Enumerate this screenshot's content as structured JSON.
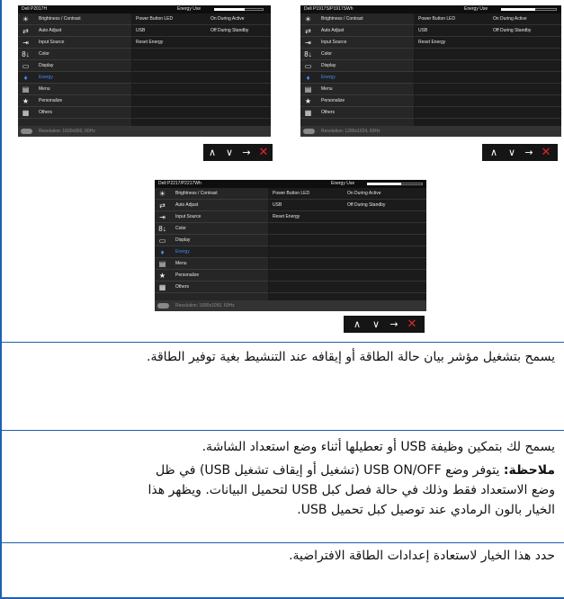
{
  "osd": {
    "menu": [
      {
        "icon": "☀",
        "icon_name": "brightness-icon",
        "label": "Brightness / Contrast"
      },
      {
        "icon": "⇄",
        "icon_name": "auto-adjust-icon",
        "label": "Auto Adjust"
      },
      {
        "icon": "⇥",
        "icon_name": "input-source-icon",
        "label": "Input Source"
      },
      {
        "icon": "8↓",
        "icon_name": "color-icon",
        "label": "Color"
      },
      {
        "icon": "▭",
        "icon_name": "display-icon",
        "label": "Display"
      },
      {
        "icon": "♦",
        "icon_name": "energy-icon",
        "label": "Energy"
      },
      {
        "icon": "▤",
        "icon_name": "menu-icon",
        "label": "Menu"
      },
      {
        "icon": "★",
        "icon_name": "personalize-icon",
        "label": "Personalize"
      },
      {
        "icon": "▦",
        "icon_name": "others-icon",
        "label": "Others"
      }
    ],
    "section_title": "Energy Use",
    "energy_level": 0.62,
    "settings": [
      {
        "key": "Power Button LED",
        "value": "On During Active"
      },
      {
        "key": "USB",
        "value": "Off During Standby"
      },
      {
        "key": "Reset Energy",
        "value": ""
      }
    ],
    "screens": [
      {
        "model": "Dell P2017H",
        "resolution": "Resolution: 1600x900, 60Hz"
      },
      {
        "model": "Dell P1917S/P1917SWh",
        "resolution": "Resolution: 1280x1024, 60Hz"
      },
      {
        "model": "Dell P2217/P2217Wh",
        "resolution": "Resolution: 1680x1050, 60Hz"
      }
    ],
    "nav": [
      "∧",
      "∨",
      "→",
      "✕"
    ]
  },
  "text": {
    "led_desc": "يسمح بتشغيل مؤشر بيان حالة الطاقة أو إيقافه عند التنشيط بغية توفير الطاقة.",
    "usb_desc": "يسمح لك بتمكين وظيفة USB أو تعطيلها أثناء وضع استعداد الشاشة.",
    "note_label": "ملاحظة:",
    "note_line1": "يتوفر وضع USB ON/OFF (تشغيل أو إيقاف تشغيل USB) في ظل",
    "note_line2": "وضع الاستعداد فقط وذلك في حالة فصل كبل USB لتحميل البيانات. ويظهر هذا",
    "note_line3": "الخيار بالون الرمادي عند توصيل كبل تحميل USB.",
    "reset_desc": "حدد هذا الخيار لاستعادة إعدادات الطاقة الافتراضية."
  }
}
